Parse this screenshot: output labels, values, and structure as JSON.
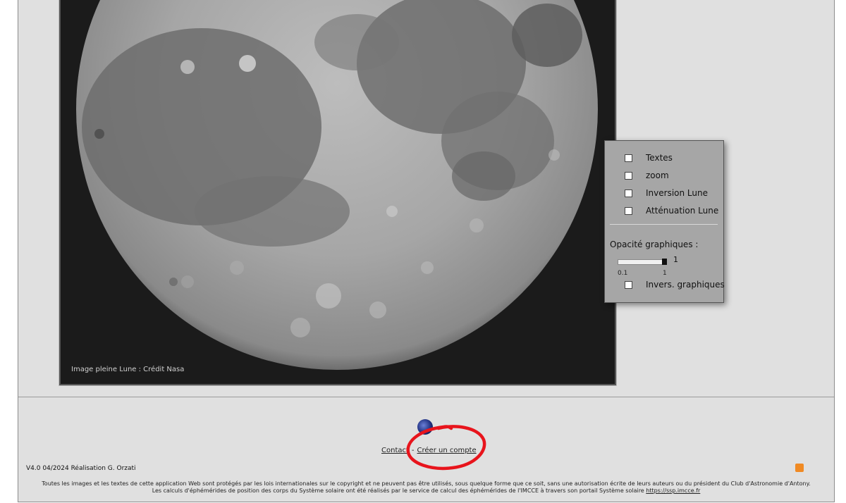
{
  "moon": {
    "credit": "Image pleine Lune : Crédit Nasa"
  },
  "options": {
    "items": [
      {
        "label": "Textes",
        "checked": false
      },
      {
        "label": "zoom",
        "checked": false
      },
      {
        "label": "Inversion Lune",
        "checked": false
      },
      {
        "label": "Atténuation Lune",
        "checked": false
      }
    ],
    "opacity_label": "Opacité graphiques :",
    "opacity_value": "1",
    "opacity_min": "0.1",
    "opacity_max": "1",
    "opacity_level": 1,
    "invert_graphics": {
      "label": "Invers. graphiques",
      "checked": false
    }
  },
  "footer": {
    "contact_label": "Contact",
    "separator": "-",
    "create_account_label": "Créer un compte",
    "version": "V4.0 04/2024 Réalisation G. Orzati",
    "legal_line1": "Toutes les images et les textes de cette application Web sont protégés par les lois internationales sur le copyright et ne peuvent pas être utilisés, sous quelque forme que ce soit, sans une autorisation écrite de leurs auteurs ou du président du Club d'Astronomie d'Antony.",
    "legal_line2": "Les calculs d'éphémérides de position des corps du Système solaire ont été réalisés par le service de calcul des éphémérides de l'IMCCE à travers son portail Système solaire",
    "legal_link": "https://ssp.imcce.fr"
  },
  "colors": {
    "annotation_circle": "#e8141c",
    "rss": "#f08a24",
    "panel_bg": "#a6a6a6",
    "page_bg": "#e0e0e0"
  },
  "icons": {
    "logo": "blue-globe-logo",
    "rss": "rss-feed-icon"
  }
}
